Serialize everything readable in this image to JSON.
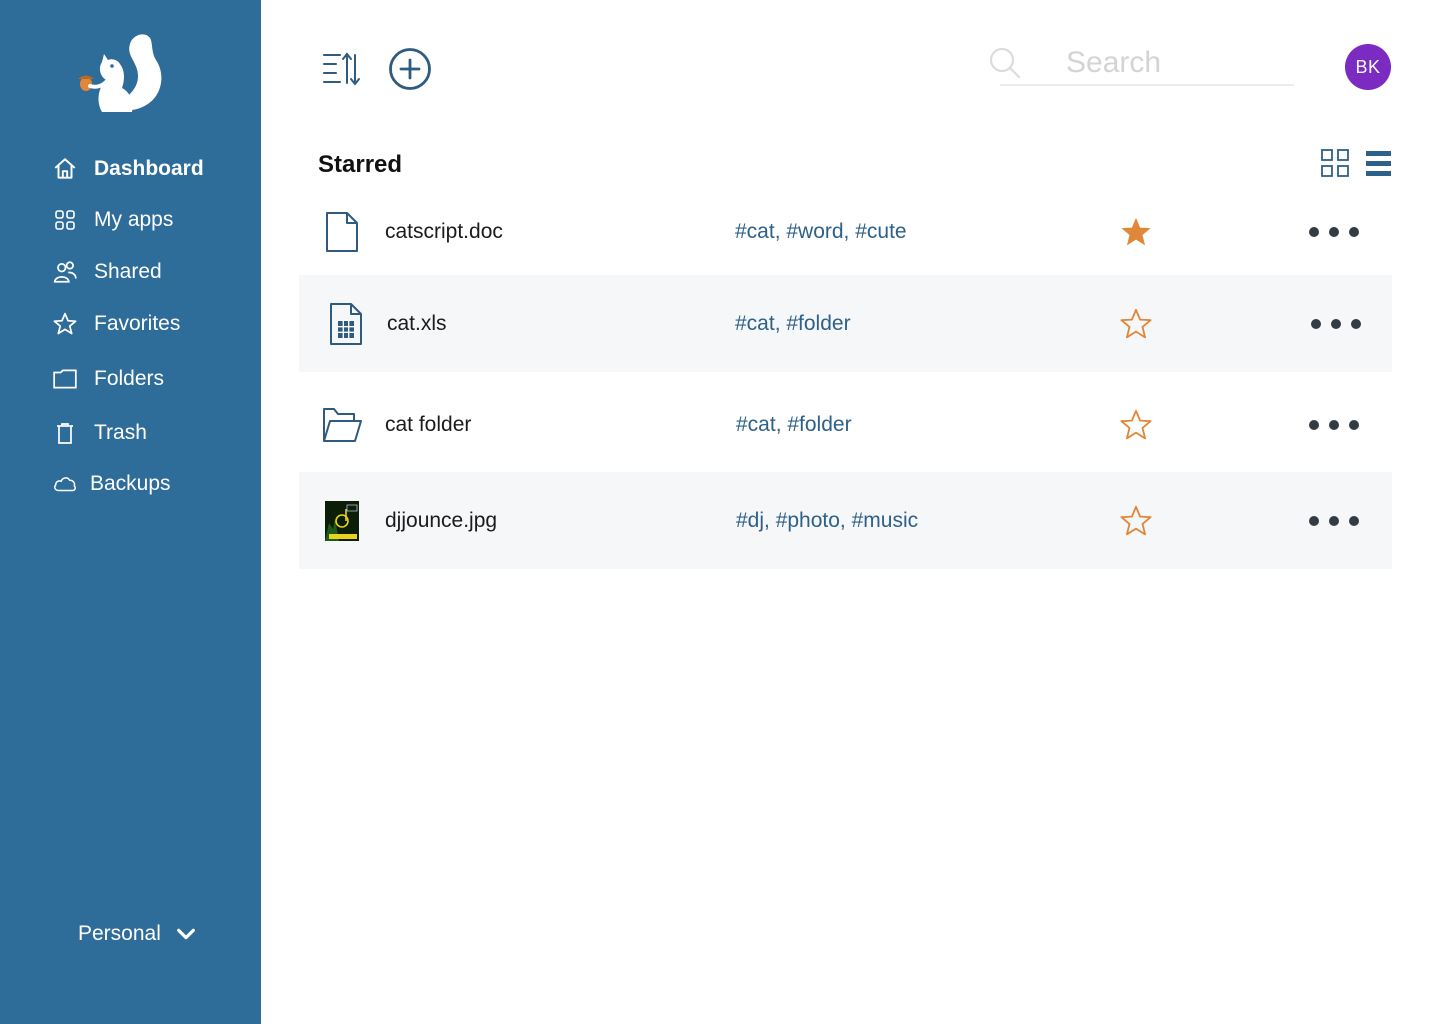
{
  "sidebar": {
    "nav": [
      {
        "label": "Dashboard",
        "icon": "home-icon",
        "active": true
      },
      {
        "label": "My apps",
        "icon": "apps-icon"
      },
      {
        "label": "Shared",
        "icon": "users-icon"
      },
      {
        "label": "Favorites",
        "icon": "star-icon"
      },
      {
        "label": "Folders",
        "icon": "folder-icon"
      },
      {
        "label": "Trash",
        "icon": "trash-icon"
      },
      {
        "label": "Backups",
        "icon": "cloud-icon"
      }
    ],
    "account_label": "Personal"
  },
  "topbar": {
    "search_placeholder": "Search",
    "avatar_initials": "BK"
  },
  "section": {
    "title": "Starred"
  },
  "files": [
    {
      "name": "catscript.doc",
      "tags": "#cat, #word, #cute",
      "type": "document",
      "starred": true
    },
    {
      "name": "cat.xls",
      "tags": "#cat, #folder",
      "type": "spreadsheet",
      "starred": false
    },
    {
      "name": "cat folder",
      "tags": "#cat, #folder",
      "type": "folder",
      "starred": false
    },
    {
      "name": "djjounce.jpg",
      "tags": "#dj, #photo, #music",
      "type": "image",
      "starred": false
    }
  ],
  "colors": {
    "sidebar": "#2e6c9a",
    "accent": "#2e6189",
    "star": "#e0873a",
    "avatar": "#7b2ac2"
  }
}
